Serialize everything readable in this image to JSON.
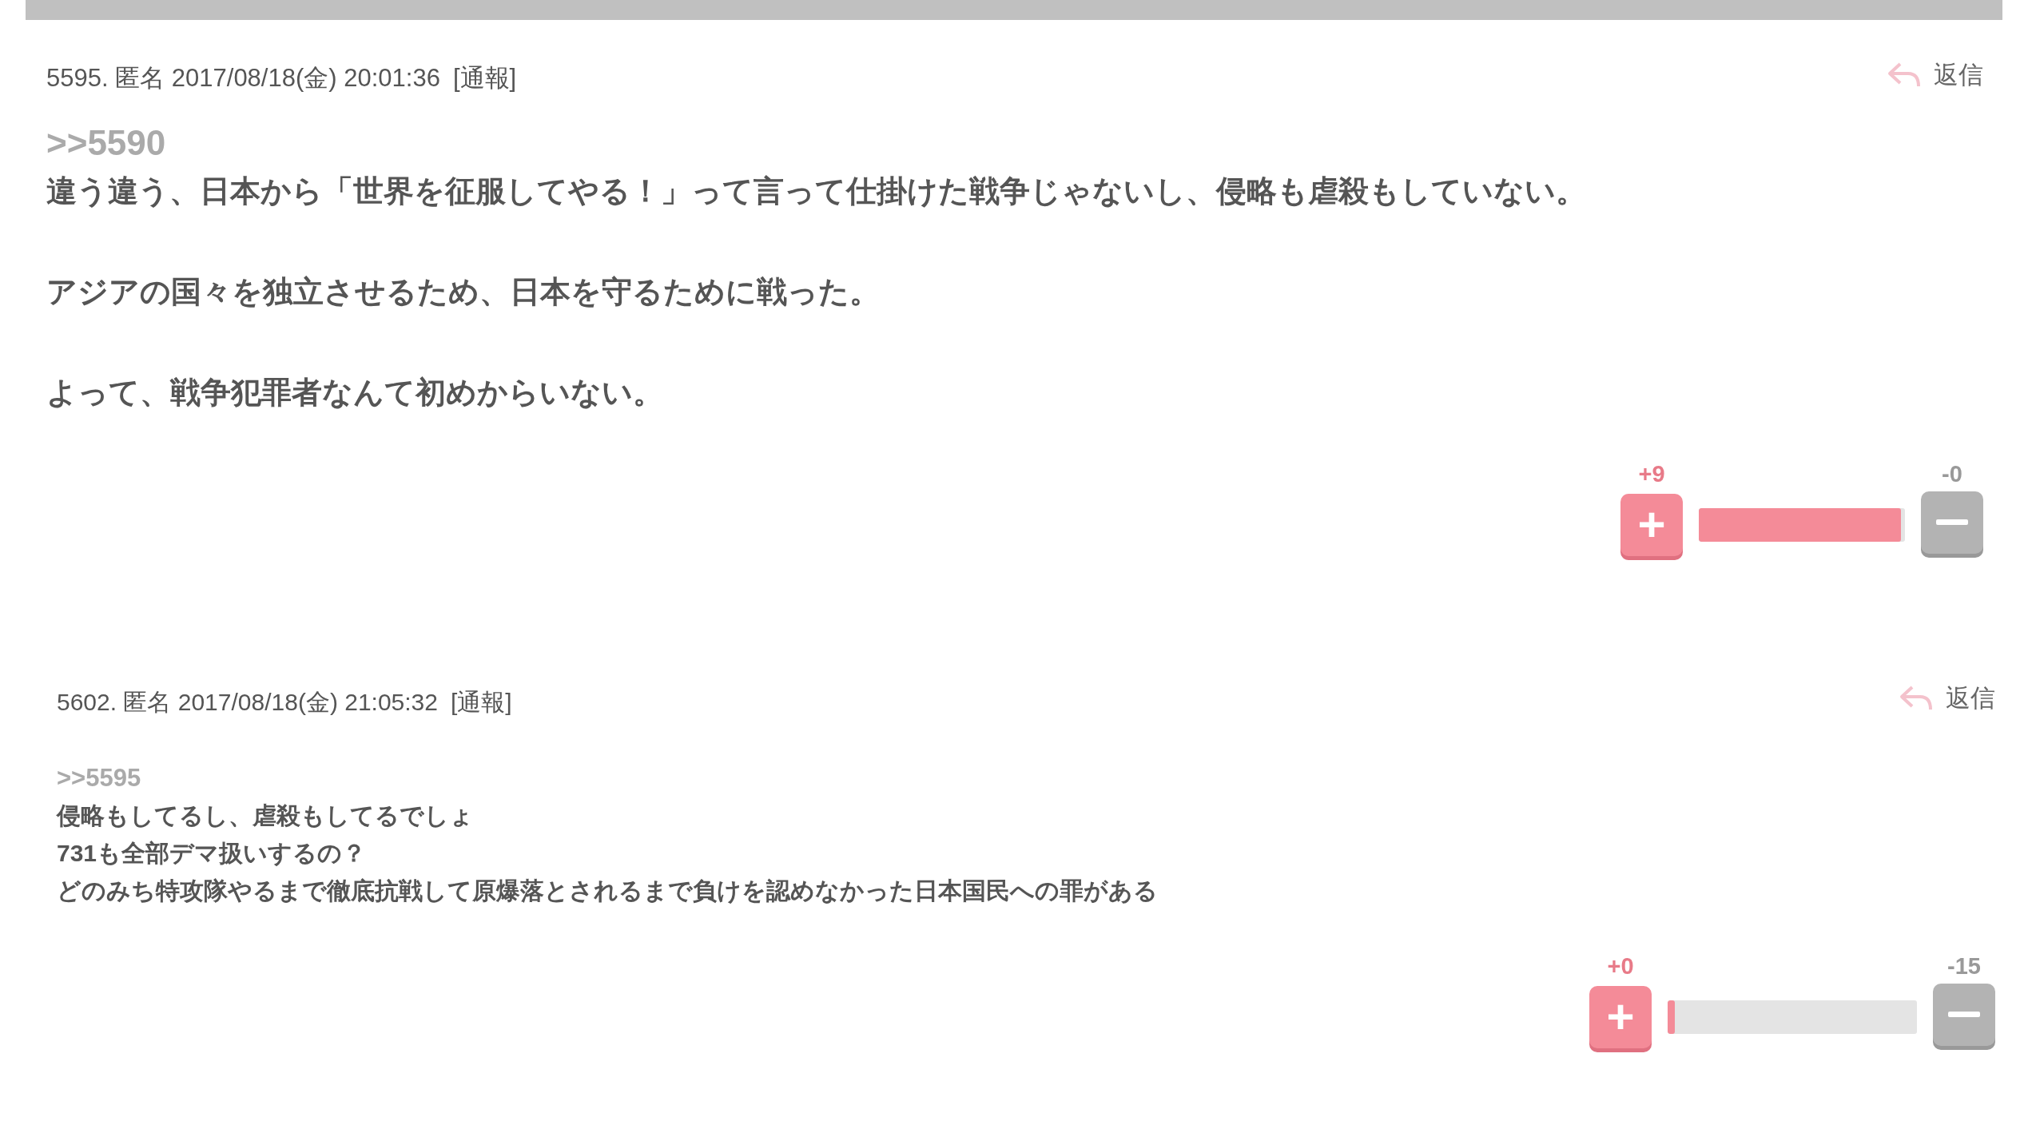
{
  "posts": [
    {
      "kind": "large",
      "meta": "5595. 匿名 2017/08/18(金) 20:01:36",
      "report": "[通報]",
      "reply": "返信",
      "anchor": ">>5590",
      "paragraphs": [
        "違う違う、日本から「世界を征服してやる！」って言って仕掛けた戦争じゃないし、侵略も虐殺もしていない。",
        "アジアの国々を独立させるため、日本を守るために戦った。",
        "よって、戦争犯罪者なんて初めからいない。"
      ],
      "vote": {
        "plus_icon": "+",
        "plus": "+9",
        "minus": "-0",
        "level": 0.98
      }
    },
    {
      "kind": "normal",
      "meta": "5602. 匿名 2017/08/18(金) 21:05:32",
      "report": "[通報]",
      "reply": "返信",
      "anchor": ">>5595",
      "paragraphs": [
        "侵略もしてるし、虐殺もしてるでしょ",
        "731も全部デマ扱いするの？",
        "どのみち特攻隊やるまで徹底抗戦して原爆落とされるまで負けを認めなかった日本国民への罪がある"
      ],
      "vote": {
        "plus_icon": "+",
        "plus": "+0",
        "minus": "-15",
        "level": 0.03
      }
    }
  ]
}
